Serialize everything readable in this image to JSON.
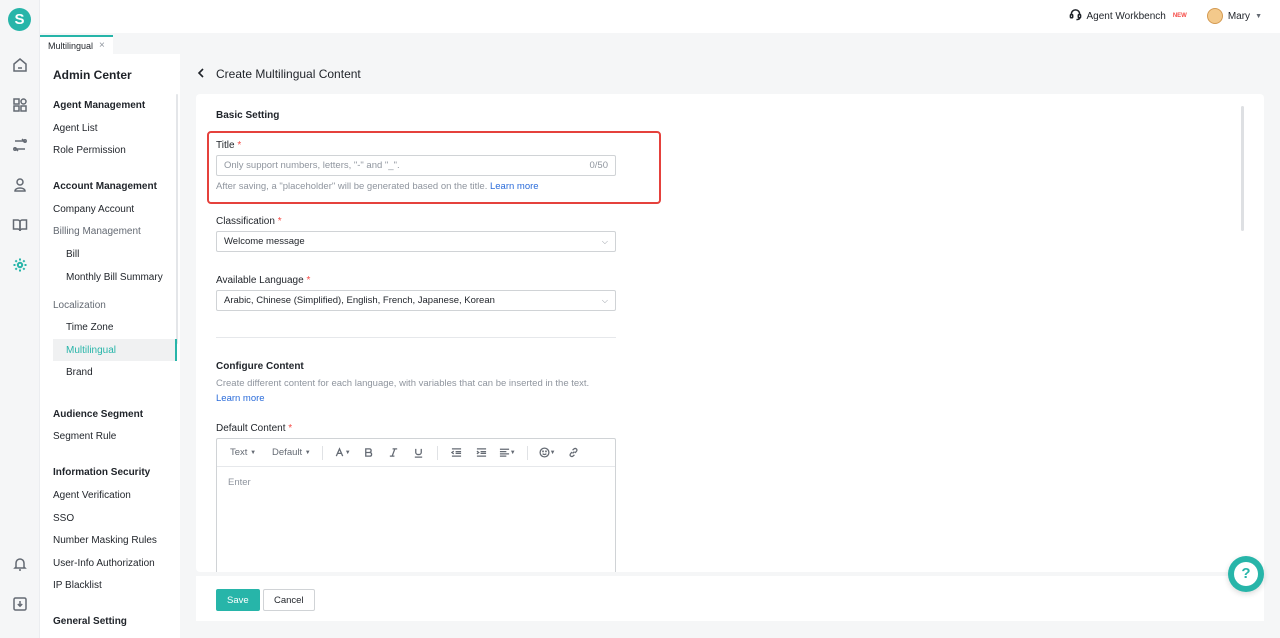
{
  "app": {
    "logo_letter": "S"
  },
  "rail": {
    "icons": [
      "home-icon",
      "apps-icon",
      "routing-icon",
      "agent-icon",
      "book-icon",
      "settings-icon",
      "bell-icon",
      "download-icon"
    ]
  },
  "topbar": {
    "workbench_label": "Agent Workbench",
    "workbench_badge": "NEW",
    "user_name": "Mary"
  },
  "tabs": [
    {
      "label": "Multilingual",
      "close": "×"
    }
  ],
  "sidenav": {
    "title": "Admin Center",
    "groups": {
      "agent": "Agent Management",
      "account": "Account Management",
      "audience": "Audience Segment",
      "security": "Information Security",
      "general": "General Setting"
    },
    "items": {
      "agent_list": "Agent List",
      "role_permission": "Role Permission",
      "company_account": "Company Account",
      "billing_management": "Billing Management",
      "bill": "Bill",
      "monthly_bill_summary": "Monthly Bill Summary",
      "localization": "Localization",
      "time_zone": "Time Zone",
      "multilingual": "Multilingual",
      "brand": "Brand",
      "segment_rule": "Segment Rule",
      "agent_verification": "Agent Verification",
      "sso": "SSO",
      "number_masking": "Number Masking Rules",
      "user_info_auth": "User-Info Authorization",
      "ip_blacklist": "IP Blacklist"
    }
  },
  "page": {
    "title": "Create Multilingual Content",
    "basic_setting": "Basic Setting",
    "title_field": {
      "label": "Title",
      "required": "*",
      "placeholder": "Only support numbers, letters, \"-\" and \"_\".",
      "count": "0/50",
      "helper": "After saving, a \"placeholder\" will be generated based on the title.",
      "helper_link": "Learn more"
    },
    "classification": {
      "label": "Classification",
      "required": "*",
      "value": "Welcome message"
    },
    "language": {
      "label": "Available Language",
      "required": "*",
      "value": "Arabic, Chinese (Simplified), English, French, Japanese, Korean"
    },
    "configure": {
      "title": "Configure Content",
      "description": "Create different content for each language, with variables that can be inserted in the text.",
      "link": "Learn more"
    },
    "default_content": {
      "label": "Default Content",
      "required": "*",
      "toolbar": {
        "text_style": "Text",
        "font_size": "Default"
      },
      "placeholder": "Enter"
    },
    "footer": {
      "save": "Save",
      "cancel": "Cancel"
    }
  },
  "colors": {
    "accent": "#27b5a9",
    "highlight": "#e5413c",
    "link": "#2b6cda"
  }
}
